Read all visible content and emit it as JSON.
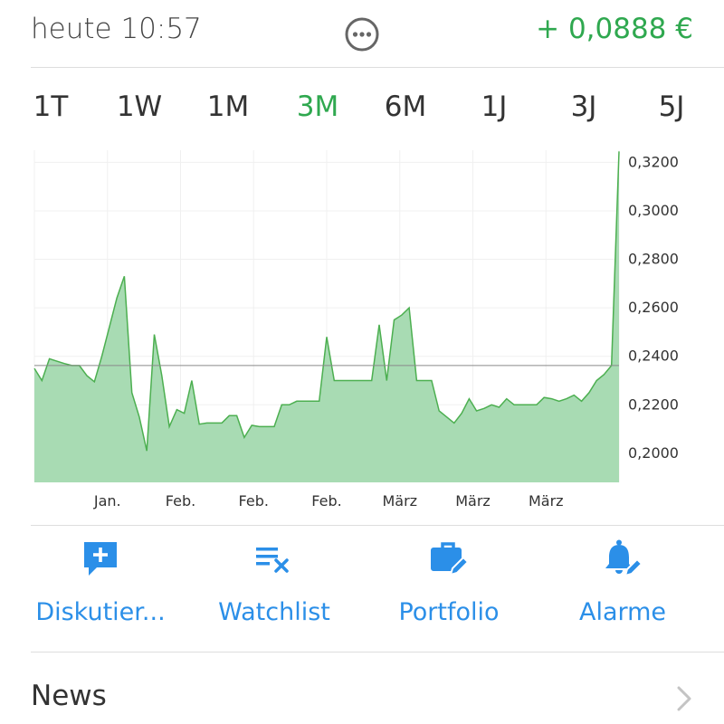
{
  "header": {
    "time": "heute 10:57",
    "change": "+ 0,0888 €",
    "more_icon": "more-horizontal-circle-icon"
  },
  "tabs": [
    {
      "label": "1T",
      "active": false
    },
    {
      "label": "1W",
      "active": false
    },
    {
      "label": "1M",
      "active": false
    },
    {
      "label": "3M",
      "active": true
    },
    {
      "label": "6M",
      "active": false
    },
    {
      "label": "1J",
      "active": false
    },
    {
      "label": "3J",
      "active": false
    },
    {
      "label": "5J",
      "active": false
    }
  ],
  "chart_data": {
    "type": "area",
    "x_tick_labels": [
      "Jan.",
      "Feb.",
      "Feb.",
      "Feb.",
      "März",
      "März",
      "März"
    ],
    "y_tick_labels": [
      "0,3200",
      "0,3000",
      "0,2800",
      "0,2600",
      "0,2400",
      "0,2200",
      "0,2000"
    ],
    "y_ticks": [
      0.32,
      0.3,
      0.28,
      0.26,
      0.24,
      0.22,
      0.2
    ],
    "ylim": [
      0.188,
      0.325
    ],
    "reference_value": 0.2362,
    "values": [
      0.235,
      0.23,
      0.239,
      0.238,
      0.237,
      0.2362,
      0.2362,
      0.232,
      0.2295,
      0.24,
      0.252,
      0.264,
      0.273,
      0.225,
      0.215,
      0.201,
      0.249,
      0.232,
      0.211,
      0.218,
      0.2165,
      0.23,
      0.212,
      0.2125,
      0.2125,
      0.2125,
      0.2155,
      0.2155,
      0.2065,
      0.2115,
      0.211,
      0.211,
      0.211,
      0.22,
      0.22,
      0.2215,
      0.2215,
      0.2215,
      0.2215,
      0.248,
      0.23,
      0.23,
      0.23,
      0.23,
      0.23,
      0.23,
      0.253,
      0.23,
      0.255,
      0.257,
      0.26,
      0.23,
      0.23,
      0.23,
      0.2175,
      0.215,
      0.2125,
      0.2165,
      0.2225,
      0.2175,
      0.2185,
      0.22,
      0.219,
      0.2225,
      0.22,
      0.22,
      0.22,
      0.22,
      0.223,
      0.2225,
      0.2215,
      0.2225,
      0.224,
      0.2215,
      0.225,
      0.23,
      0.2325,
      0.2362,
      0.3245
    ],
    "grid": true,
    "line_color": "#4caf50",
    "fill_color": "#a8dbb3"
  },
  "actions": [
    {
      "label": "Diskutier...",
      "icon": "chat-plus-icon"
    },
    {
      "label": "Watchlist",
      "icon": "watchlist-remove-icon"
    },
    {
      "label": "Portfolio",
      "icon": "briefcase-edit-icon"
    },
    {
      "label": "Alarme",
      "icon": "bell-edit-icon"
    }
  ],
  "news": {
    "title": "News",
    "icon": "chevron-right-icon"
  },
  "colors": {
    "accent_green": "#2fa84f",
    "action_blue": "#2b8fe8"
  }
}
